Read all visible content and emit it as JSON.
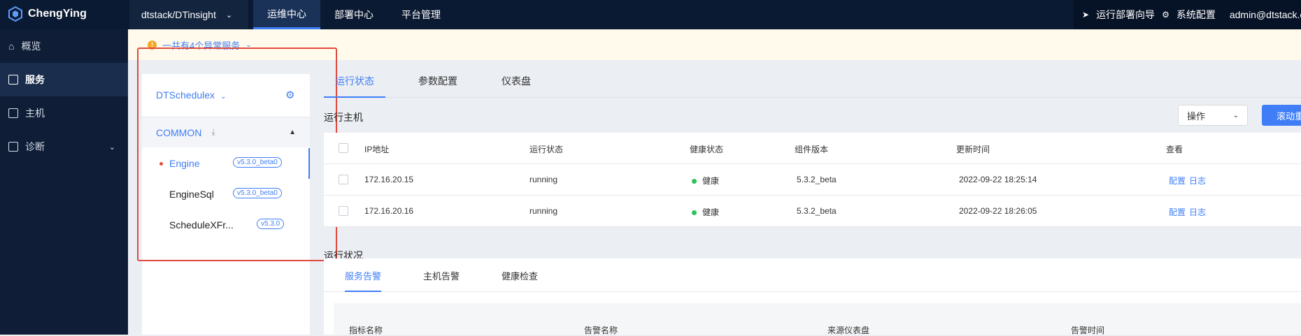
{
  "topbar": {
    "brand": "ChengYing",
    "project": "dtstack/DTinsight",
    "nav": [
      "运维中心",
      "部署中心",
      "平台管理"
    ],
    "active_nav": "运维中心",
    "right": {
      "guide": "运行部署向导",
      "config": "系统配置",
      "user": "admin@dtstack.c"
    }
  },
  "sidebar": {
    "items": [
      {
        "label": "概览",
        "icon": "home-icon"
      },
      {
        "label": "服务",
        "icon": "service-icon",
        "active": true
      },
      {
        "label": "主机",
        "icon": "host-icon"
      },
      {
        "label": "诊断",
        "icon": "diagnose-icon"
      }
    ]
  },
  "alert": {
    "text": "一共有4个异常服务",
    "icon": "!"
  },
  "left_panel": {
    "service": "DTSchedulex",
    "group": "COMMON",
    "components": [
      {
        "name": "Engine",
        "version": "v5.3.0_beta0",
        "active": true
      },
      {
        "name": "EngineSql",
        "version": "v5.3.0_beta0"
      },
      {
        "name": "ScheduleXFr...",
        "version": "v5.3.0"
      }
    ]
  },
  "main": {
    "tabs": [
      "运行状态",
      "参数配置",
      "仪表盘"
    ],
    "hosts_title": "运行主机",
    "op_select": "操作",
    "blue_button": "滚动重",
    "columns": [
      "IP地址",
      "运行状态",
      "健康状态",
      "组件版本",
      "更新时间",
      "查看"
    ],
    "rows": [
      {
        "ip": "172.16.20.15",
        "status": "running",
        "health": "健康",
        "version": "5.3.2_beta",
        "updated": "2022-09-22 18:25:14",
        "links": [
          "配置",
          "日志"
        ]
      },
      {
        "ip": "172.16.20.16",
        "status": "running",
        "health": "健康",
        "version": "5.3.2_beta",
        "updated": "2022-09-22 18:26:05",
        "links": [
          "配置",
          "日志"
        ]
      }
    ],
    "status_title": "运行状况",
    "sub_tabs": [
      "服务告警",
      "主机告警",
      "健康检查"
    ],
    "alarm_columns": [
      "指标名称",
      "告警名称",
      "来源仪表盘",
      "告警时间"
    ]
  },
  "colors": {
    "accent": "#3f7ef7",
    "topbar": "#0b1a33",
    "highlight_box": "#e04b3e",
    "healthy": "#2fc25b"
  }
}
